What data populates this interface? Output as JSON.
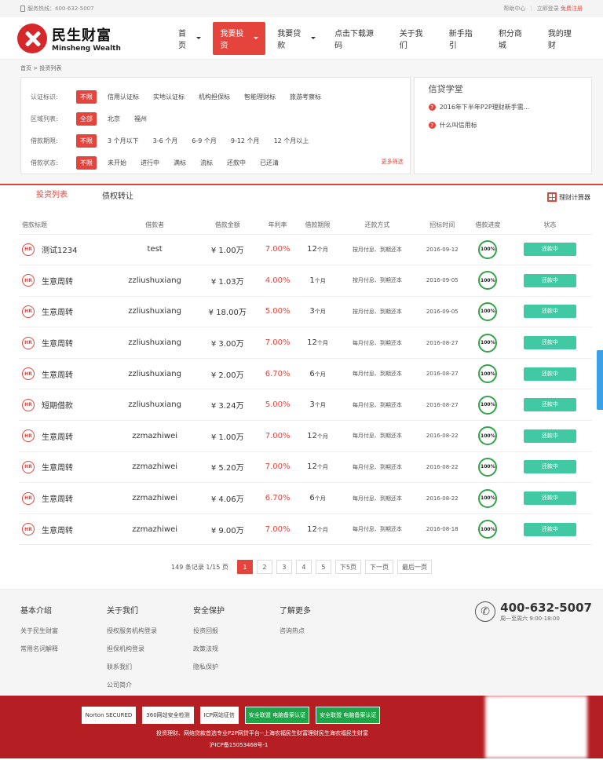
{
  "topbar": {
    "hotline_label": "服务热线：400-632-5007",
    "help": "帮助中心",
    "login": "立即登录",
    "register": "免费注册"
  },
  "header": {
    "logo_cn": "民生财富",
    "logo_en": "Minsheng Wealth",
    "nav": [
      {
        "label": "首页",
        "caret": true
      },
      {
        "label": "我要投资",
        "caret": true,
        "active": true
      },
      {
        "label": "我要贷款",
        "caret": true
      },
      {
        "label": "点击下载源码"
      },
      {
        "label": "关于我们"
      },
      {
        "label": "新手指引"
      },
      {
        "label": "积分商城"
      },
      {
        "label": "我的理财"
      }
    ]
  },
  "breadcrumb": "首页 > 投资列表",
  "filters": [
    {
      "label": "认证标识:",
      "options": [
        "不限",
        "信用认证标",
        "实地认证标",
        "机构担保标",
        "智能理财标",
        "旅游考察标"
      ]
    },
    {
      "label": "区域列表:",
      "options": [
        "全部",
        "北京",
        "福州"
      ]
    },
    {
      "label": "借款期限:",
      "options": [
        "不限",
        "3 个月以下",
        "3-6 个月",
        "6-9 个月",
        "9-12 个月",
        "12 个月以上"
      ]
    },
    {
      "label": "借款状态:",
      "options": [
        "不限",
        "未开始",
        "进行中",
        "满标",
        "流标",
        "还款中",
        "已还清"
      ]
    }
  ],
  "more_filter": "更多筛选",
  "learn": {
    "title": "信贷学堂",
    "items": [
      "2016年下半年P2P理财新手需...",
      "什么叫信用标"
    ]
  },
  "tabs": [
    "投资列表",
    "债权转让"
  ],
  "calculator": "理财计算器",
  "table": {
    "headers": [
      "借款标题",
      "借款者",
      "借款金额",
      "年利率",
      "借款期限",
      "还款方式",
      "招标时间",
      "借款进度",
      "状态"
    ],
    "rows": [
      {
        "title": "测试1234",
        "borrower": "test",
        "amount": "¥ 1.00万",
        "rate": "7.00%",
        "period": "12",
        "unit": "个月",
        "method": "按月付息、到期还本",
        "date": "2016-09-12",
        "progress": "100%",
        "status": "还款中"
      },
      {
        "title": "生意周转",
        "borrower": "zzliushuxiang",
        "amount": "¥ 1.03万",
        "rate": "4.00%",
        "period": "1",
        "unit": "个月",
        "method": "按月付息、到期还本",
        "date": "2016-09-05",
        "progress": "100%",
        "status": "还款中"
      },
      {
        "title": "生意周转",
        "borrower": "zzliushuxiang",
        "amount": "¥ 18.00万",
        "rate": "5.00%",
        "period": "3",
        "unit": "个月",
        "method": "按月付息、到期还本",
        "date": "2016-09-05",
        "progress": "100%",
        "status": "还款中"
      },
      {
        "title": "生意周转",
        "borrower": "zzliushuxiang",
        "amount": "¥ 3.00万",
        "rate": "7.00%",
        "period": "12",
        "unit": "个月",
        "method": "每月付息、到期还本",
        "date": "2016-08-27",
        "progress": "100%",
        "status": "还款中"
      },
      {
        "title": "生意周转",
        "borrower": "zzliushuxiang",
        "amount": "¥ 2.00万",
        "rate": "6.70%",
        "period": "6",
        "unit": "个月",
        "method": "每月付息、到期还本",
        "date": "2016-08-27",
        "progress": "100%",
        "status": "还款中"
      },
      {
        "title": "短期借款",
        "borrower": "zzliushuxiang",
        "amount": "¥ 3.24万",
        "rate": "5.00%",
        "period": "3",
        "unit": "个月",
        "method": "每月付息、到期还本",
        "date": "2016-08-27",
        "progress": "100%",
        "status": "还款中"
      },
      {
        "title": "生意周转",
        "borrower": "zzmazhiwei",
        "amount": "¥ 1.00万",
        "rate": "7.00%",
        "period": "12",
        "unit": "个月",
        "method": "每月付息、到期还本",
        "date": "2016-08-22",
        "progress": "100%",
        "status": "还款中"
      },
      {
        "title": "生意周转",
        "borrower": "zzmazhiwei",
        "amount": "¥ 5.20万",
        "rate": "7.00%",
        "period": "12",
        "unit": "个月",
        "method": "每月付息、到期还本",
        "date": "2016-08-22",
        "progress": "100%",
        "status": "还款中"
      },
      {
        "title": "生意周转",
        "borrower": "zzmazhiwei",
        "amount": "¥ 4.06万",
        "rate": "6.70%",
        "period": "6",
        "unit": "个月",
        "method": "每月付息、到期还本",
        "date": "2016-08-22",
        "progress": "100%",
        "status": "还款中"
      },
      {
        "title": "生意周转",
        "borrower": "zzmazhiwei",
        "amount": "¥ 9.00万",
        "rate": "7.00%",
        "period": "12",
        "unit": "个月",
        "method": "每月付息、到期还本",
        "date": "2016-08-18",
        "progress": "100%",
        "status": "还款中"
      }
    ]
  },
  "pager": {
    "info": "149 条记录 1/15 页",
    "pages": [
      "1",
      "2",
      "3",
      "4",
      "5"
    ],
    "next5": "下5页",
    "next": "下一页",
    "last": "最后一页"
  },
  "footer": {
    "columns": [
      {
        "title": "基本介绍",
        "links": [
          "关于民生财富",
          "常用名词解释"
        ]
      },
      {
        "title": "关于我们",
        "links": [
          "授权服务机构登录",
          "担保机构登录",
          "联系我们",
          "公司简介"
        ]
      },
      {
        "title": "安全保护",
        "links": [
          "投资回报",
          "政策法规",
          "隐私保护"
        ]
      },
      {
        "title": "了解更多",
        "links": [
          "咨询热点"
        ]
      }
    ],
    "phone": "400-632-5007",
    "hours": "周一至周六 9:00-18:00"
  },
  "badges": [
    "Norton SECURED",
    "360网站安全检测",
    "ICP网站征信",
    "安全联盟 电脑备案认证",
    "安全联盟 电脑备案认证"
  ],
  "copyright": "投资理财、网络贷款首选专业P2P网贷平台--上海农福民生财富理财民生海农福民生财富",
  "icp": "沪ICP备15053468号-1",
  "colors": {
    "accent": "#e5443c",
    "status": "#40c9a2",
    "footer_red": "#b51e22",
    "progress": "#34a34a"
  }
}
